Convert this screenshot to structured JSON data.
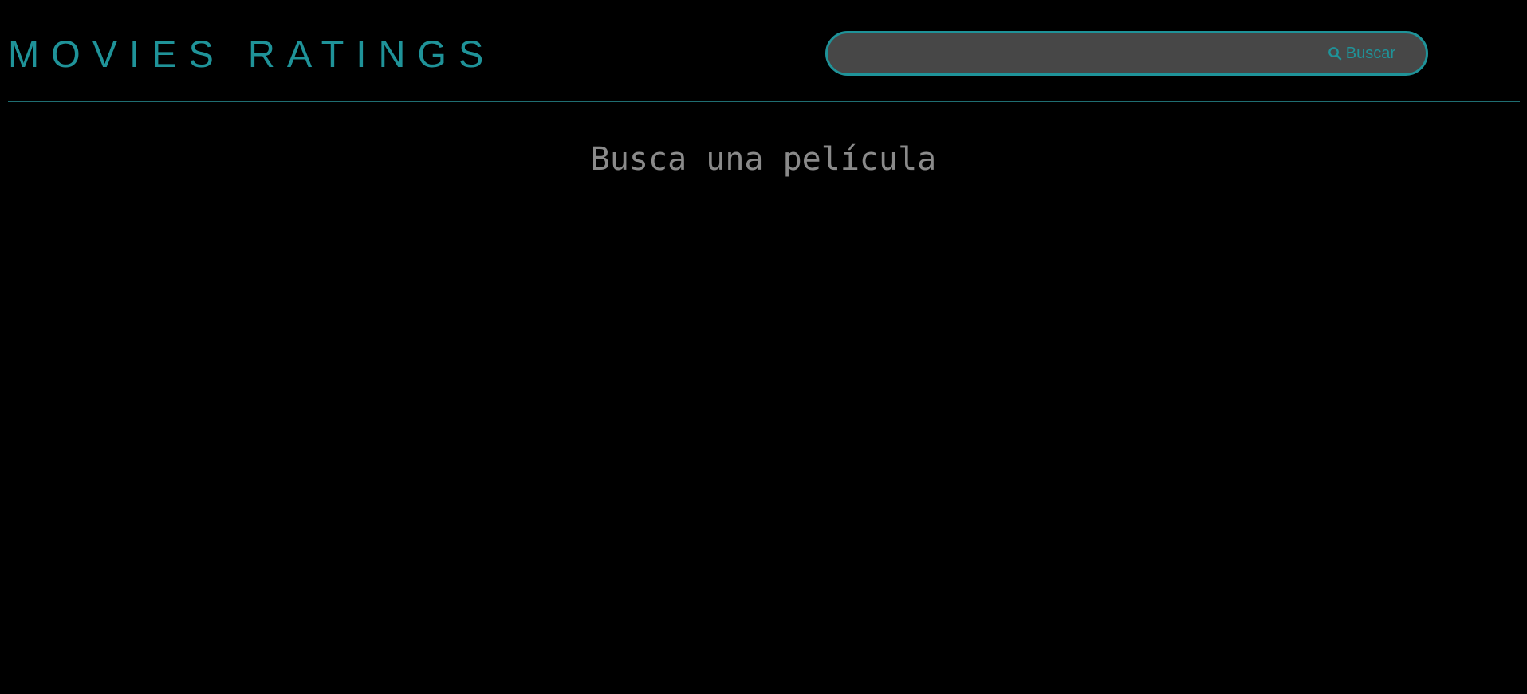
{
  "header": {
    "title": "MOVIES RATINGS"
  },
  "search": {
    "value": "",
    "placeholder": "",
    "button_label": "Buscar",
    "button_icon": "search-icon"
  },
  "main": {
    "empty_message": "Busca una película"
  },
  "colors": {
    "accent": "#1f9399",
    "background": "#000000",
    "search_bg": "#474747",
    "muted_text": "#8a8a8a"
  }
}
